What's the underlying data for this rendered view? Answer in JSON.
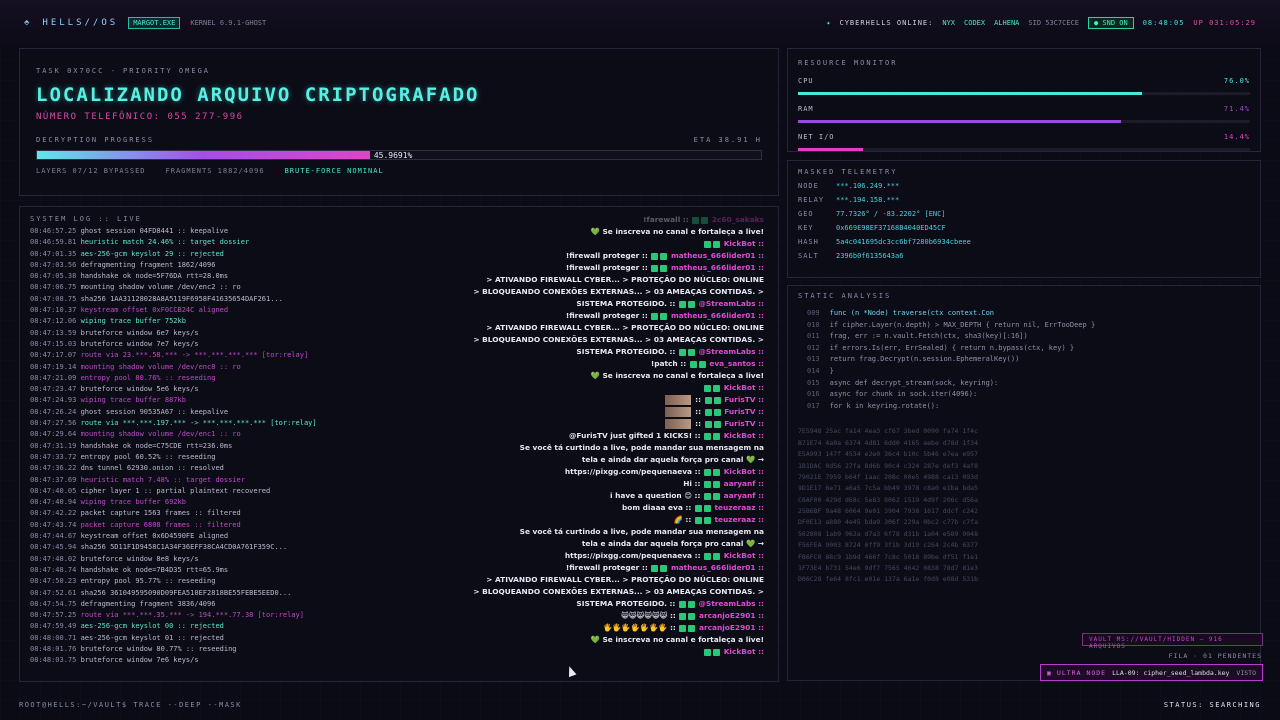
{
  "header": {
    "logo": "HELLS//OS",
    "user_tag": "MARGOT.EXE",
    "kernel": "KERNEL 6.9.1-GHOST",
    "online_label": "CYBERHELLS ONLINE:",
    "online_users": [
      "NYX",
      "CODEX",
      "ALHENA"
    ],
    "sid": "SID 53C7CECE",
    "snd": "SND ON",
    "clock": "08:48:05",
    "uptime": "UP 031:05:29"
  },
  "task": {
    "label": "TASK 0X70CC - PRIORITY OMEGA",
    "title": "LOCALIZANDO ARQUIVO CRIPTOGRAFADO",
    "phone": "NÚMERO TELEFÔNICO: 055 277-996",
    "progress_label": "DECRYPTION PROGRESS",
    "eta": "ETA 38.91 H",
    "progress_text": "45.9691%",
    "progress": 0.459691,
    "layers": "LAYERS 07/12 BYPASSED",
    "fragments": "FRAGMENTS 1882/4096",
    "brute": "BRUTE-FORCE NOMINAL"
  },
  "log": {
    "title": "SYSTEM LOG :: LIVE",
    "lines": [
      {
        "t": "08:46:57.25",
        "m": "ghost session 04FD8441 :: keepalive",
        "c": "w"
      },
      {
        "t": "08:46:59.81",
        "m": "heuristic match 24.46% :: target dossier",
        "c": "g"
      },
      {
        "t": "08:47:01.35",
        "m": "aes-256-gcm keyslot 29 :: rejected",
        "c": "g"
      },
      {
        "t": "08:47:03.56",
        "m": "defragmenting fragment 1862/4096",
        "c": "w"
      },
      {
        "t": "08:47:05.38",
        "m": "handshake ok node=5F76DA rtt=28.0ms",
        "c": "w"
      },
      {
        "t": "08:47:06.75",
        "m": "mounting shadow volume /dev/enc2 :: ro",
        "c": "w"
      },
      {
        "t": "08:47:08.75",
        "m": "sha256 1AA31128028A8A5119F6958F41635654DAF261...",
        "c": "w"
      },
      {
        "t": "08:47:10.37",
        "m": "keystream offset 0xF0CCB24C aligned",
        "c": "p"
      },
      {
        "t": "08:47:12.06",
        "m": "wiping trace buffer 752kb",
        "c": "g"
      },
      {
        "t": "08:47:13.59",
        "m": "bruteforce window 6e7 keys/s",
        "c": "w"
      },
      {
        "t": "08:47:15.03",
        "m": "bruteforce window 7e7 keys/s",
        "c": "w"
      },
      {
        "t": "08:47:17.07",
        "m": "route via 23.***.58.*** -> ***.***.***.*** [tor:relay]",
        "c": "p"
      },
      {
        "t": "08:47:19.14",
        "m": "mounting shadow volume /dev/enc8 :: ro",
        "c": "p"
      },
      {
        "t": "08:47:21.09",
        "m": "entropy pool 80.76% :: reseeding",
        "c": "p"
      },
      {
        "t": "08:47:23.47",
        "m": "bruteforce window 5e6 keys/s",
        "c": "w"
      },
      {
        "t": "08:47:24.93",
        "m": "wiping trace buffer 887kb",
        "c": "p"
      },
      {
        "t": "08:47:26.24",
        "m": "ghost session 90535A67 :: keepalive",
        "c": "w"
      },
      {
        "t": "08:47:27.56",
        "m": "route via ***.***.197.*** -> ***.***.***.*** [tor:relay]",
        "c": "g"
      },
      {
        "t": "08:47:29.64",
        "m": "mounting shadow volume /dev/enc1 :: ro",
        "c": "p"
      },
      {
        "t": "08:47:31.19",
        "m": "handshake ok node=C75CDE rtt=236.0ms",
        "c": "w"
      },
      {
        "t": "08:47:33.72",
        "m": "entropy pool 60.52% :: reseeding",
        "c": "w"
      },
      {
        "t": "08:47:36.22",
        "m": "dns tunnel 62930.onion :: resolved",
        "c": "w"
      },
      {
        "t": "08:47:37.69",
        "m": "heuristic match 7.48% :: target dossier",
        "c": "p"
      },
      {
        "t": "08:47:40.05",
        "m": "cipher layer 1 :: partial plaintext recovered",
        "c": "w"
      },
      {
        "t": "08:47:40.94",
        "m": "wiping trace buffer 692kb",
        "c": "p"
      },
      {
        "t": "08:47:42.22",
        "m": "packet capture 1563 frames :: filtered",
        "c": "w"
      },
      {
        "t": "08:47:43.74",
        "m": "packet capture 6808 frames :: filtered",
        "c": "p"
      },
      {
        "t": "08:47:44.67",
        "m": "keystream offset 0x6D4590FE aligned",
        "c": "w"
      },
      {
        "t": "08:47:45.94",
        "m": "sha256 5D11F1D9458C1A34F36EFF38CA4CD0A761F359C...",
        "c": "w"
      },
      {
        "t": "08:47:48.02",
        "m": "bruteforce window 8e8 keys/s",
        "c": "w"
      },
      {
        "t": "08:47:48.74",
        "m": "handshake ok node=7B4D35 rtt=65.9ms",
        "c": "w"
      },
      {
        "t": "08:47:50.23",
        "m": "entropy pool 95.77% :: reseeding",
        "c": "w"
      },
      {
        "t": "08:47:52.61",
        "m": "sha256 361049595090D09FEA510EF2818BE55FEBE5EED0...",
        "c": "w"
      },
      {
        "t": "08:47:54.75",
        "m": "defragmenting fragment 3836/4096",
        "c": "w"
      },
      {
        "t": "08:47:57.25",
        "m": "route via ***.***.35.*** -> 194.***.77.38 [tor:relay]",
        "c": "p"
      },
      {
        "t": "08:47:59.49",
        "m": "aes-256-gcm keyslot 00 :: rejected",
        "c": "g"
      },
      {
        "t": "08:48:00.71",
        "m": "aes-256-gcm keyslot 01 :: rejected",
        "c": "w"
      },
      {
        "t": "08:48:01.76",
        "m": "bruteforce window 80.77% :: reseeding",
        "c": "w"
      },
      {
        "t": "08:48:03.75",
        "m": "bruteforce window 7e6 keys/s",
        "c": "w"
      }
    ]
  },
  "chat": [
    {
      "msg": "!farewall ::",
      "user": "2c60_sakaks",
      "faded": true
    },
    {
      "msg": "💚 Se inscreva no canal e fortaleça a live!",
      "user": ""
    },
    {
      "msg": "",
      "user": "KickBot ::"
    },
    {
      "msg": "!firewall proteger ::",
      "user": "matheus_666lider01 ::"
    },
    {
      "msg": "!firewall proteger ::",
      "user": "matheus_666lider01 ::"
    },
    {
      "msg": "> ATIVANDO FIREWALL CYBER... > PROTEÇÃO DO NÚCLEO: ONLINE",
      "user": ""
    },
    {
      "msg": "> BLOQUEANDO CONEXÕES EXTERNAS... > 03 AMEAÇAS CONTIDAS. >",
      "user": ""
    },
    {
      "msg": "SISTEMA PROTEGIDO. ::",
      "user": "@StreamLabs ::"
    },
    {
      "msg": "!firewall proteger ::",
      "user": "matheus_666lider01 ::"
    },
    {
      "msg": "> ATIVANDO FIREWALL CYBER... > PROTEÇÃO DO NÚCLEO: ONLINE",
      "user": ""
    },
    {
      "msg": "> BLOQUEANDO CONEXÕES EXTERNAS... > 03 AMEAÇAS CONTIDAS. >",
      "user": ""
    },
    {
      "msg": "SISTEMA PROTEGIDO. ::",
      "user": "@StreamLabs ::"
    },
    {
      "msg": "!patch ::",
      "user": "eva_santos ::"
    },
    {
      "msg": "💚 Se inscreva no canal e fortaleça a live!",
      "user": ""
    },
    {
      "msg": "",
      "user": "KickBot ::"
    },
    {
      "msg": "::",
      "user": "FurisTV ::",
      "av": true
    },
    {
      "msg": "::",
      "user": "FurisTV ::",
      "av": true
    },
    {
      "msg": "::",
      "user": "FurisTV ::",
      "av": true
    },
    {
      "msg": "@FurisTV just gifted 1 KICKS! ::",
      "user": "KickBot ::"
    },
    {
      "msg": "Se você tá curtindo a live, pode mandar sua mensagem na",
      "user": ""
    },
    {
      "msg": "tela e ainda dar aquela força pro canal 💚 →",
      "user": ""
    },
    {
      "msg": "https://pixgg.com/pequenaeva ::",
      "user": "KickBot ::"
    },
    {
      "msg": "Hi ::",
      "user": "aaryanf ::"
    },
    {
      "msg": "i have a question 😊 ::",
      "user": "aaryanf ::"
    },
    {
      "msg": "bom diaaa eva ::",
      "user": "teuzeraaz ::"
    },
    {
      "msg": "🌈 ::",
      "user": "teuzeraaz ::"
    },
    {
      "msg": "Se você tá curtindo a live, pode mandar sua mensagem na",
      "user": ""
    },
    {
      "msg": "tela e ainda dar aquela força pro canal 💚 →",
      "user": ""
    },
    {
      "msg": "https://pixgg.com/pequenaeva ::",
      "user": "KickBot ::"
    },
    {
      "msg": "!firewall proteger ::",
      "user": "matheus_666lider01 ::"
    },
    {
      "msg": "> ATIVANDO FIREWALL CYBER... > PROTEÇÃO DO NÚCLEO: ONLINE",
      "user": ""
    },
    {
      "msg": "> BLOQUEANDO CONEXÕES EXTERNAS... > 03 AMEAÇAS CONTIDAS. >",
      "user": ""
    },
    {
      "msg": "SISTEMA PROTEGIDO. ::",
      "user": "@StreamLabs ::"
    },
    {
      "msg": "😸😸😸😸😸😸 ::",
      "user": "arcanjoE2901 ::"
    },
    {
      "msg": "🖐🖐🖐🖐🖐🖐🖐 ::",
      "user": "arcanjoE2901 ::"
    },
    {
      "msg": "💚 Se inscreva no canal e fortaleça a live!",
      "user": ""
    },
    {
      "msg": "",
      "user": "KickBot ::"
    }
  ],
  "resources": {
    "label": "RESOURCE MONITOR",
    "items": [
      {
        "name": "CPU",
        "value": "76.0%",
        "level": 0.76,
        "color": "#48e8e0"
      },
      {
        "name": "RAM",
        "value": "71.4%",
        "level": 0.714,
        "color": "#a048d8"
      },
      {
        "name": "NET I/O",
        "value": "14.4%",
        "level": 0.144,
        "color": "#e040c8"
      }
    ]
  },
  "telemetry": {
    "label": "MASKED TELEMETRY",
    "items": [
      {
        "k": "NODE",
        "v": "***.106.249.***"
      },
      {
        "k": "RELAY",
        "v": "***.194.158.***"
      },
      {
        "k": "GEO",
        "v": "77.7326° / -83.2202° [ENC]"
      },
      {
        "k": "KEY",
        "v": "0x669E98EF37168B4040ED45CF"
      },
      {
        "k": "HASH",
        "v": "5a4c041695dc3cc6bf7280b6934cbeee"
      },
      {
        "k": "SALT",
        "v": "2396b0f6135643a6"
      }
    ]
  },
  "static": {
    "label": "STATIC ANALYSIS",
    "code": [
      {
        "n": "009",
        "x": "func (n *Node) traverse(ctx context.Con",
        "hl": true
      },
      {
        "n": "010",
        "x": "if cipher.Layer(n.depth) > MAX_DEPTH { return nil, ErrTooDeep }"
      },
      {
        "n": "011",
        "x": "frag, err := n.vault.Fetch(ctx, sha3(key)[:16])"
      },
      {
        "n": "012",
        "x": "if errors.Is(err, ErrSealed) { return n.bypass(ctx, key) }"
      },
      {
        "n": "013",
        "x": "return frag.Decrypt(n.session.EphemeralKey())"
      },
      {
        "n": "014",
        "x": "}"
      },
      {
        "n": "015",
        "x": "async def decrypt_stream(sock, keyring):"
      },
      {
        "n": "016",
        "x": "async for chunk in sock.iter(4096):"
      },
      {
        "n": "017",
        "x": "for k in keyring.rotate():"
      }
    ],
    "hex": [
      "7E5948 25ac fa14 4ea3 cf67 3bed 0090 fa74 1f4c",
      "B71E74 4a0a 6374 4d81 6dd0 4165 aebe d78d 1f34",
      "E5A993 147f 4534 e2e0 36c4 b10c 5b46 e7ea e957",
      "1B1DAC 0d56 27fa 8d6b 90c4 c324 287e def3 4af8",
      "79021E 7959 b64f 1aac 208c 00e5 4988 ca13 093d",
      "9D1E17 6e71 a6a5 7c5a bb49 3978 c8a0 e1ba bda5",
      "C6AF00 429d d68c 5e83 8062 1519 4d9f 206c d56a",
      "25B6BF 9a48 6064 9e01 3904 7938 1617 ddcf c242",
      "DF0E13 a880 4e45 bda9 306f 229a 0bc2 c77b c7fa",
      "562808 1ab9 962a d7a3 6f78 d31b 1a04 e589 9048",
      "F56FEA 9003 8724 0ff9 3f1b 3d19 c264 2c4b 6377",
      "FB6FC0 88c9 1b9d 466f 7c8c 5018 89be df51 f1e1",
      "1F73E4 b731 54e6 9df7 7565 4642 0838 78d7 81e3",
      "D06C28 fe64 8fc1 e01e 137a 6a1e f0d8 e08d 531b"
    ]
  },
  "vault": "VAULT MS://VAULT/HIDDEN — 916 ARQUIVOS",
  "fila": "FILA · 01 PENDENTES",
  "ultra": {
    "tag": "ULTRA NODE",
    "msg": "LLA-09: cipher_seed_lambda.key. .",
    "state": "VISTO"
  },
  "bottom": {
    "cmd": "ROOT@HELLS:~/VAULT$ TRACE --DEEP --MASK",
    "status": "STATUS: SEARCHING"
  }
}
